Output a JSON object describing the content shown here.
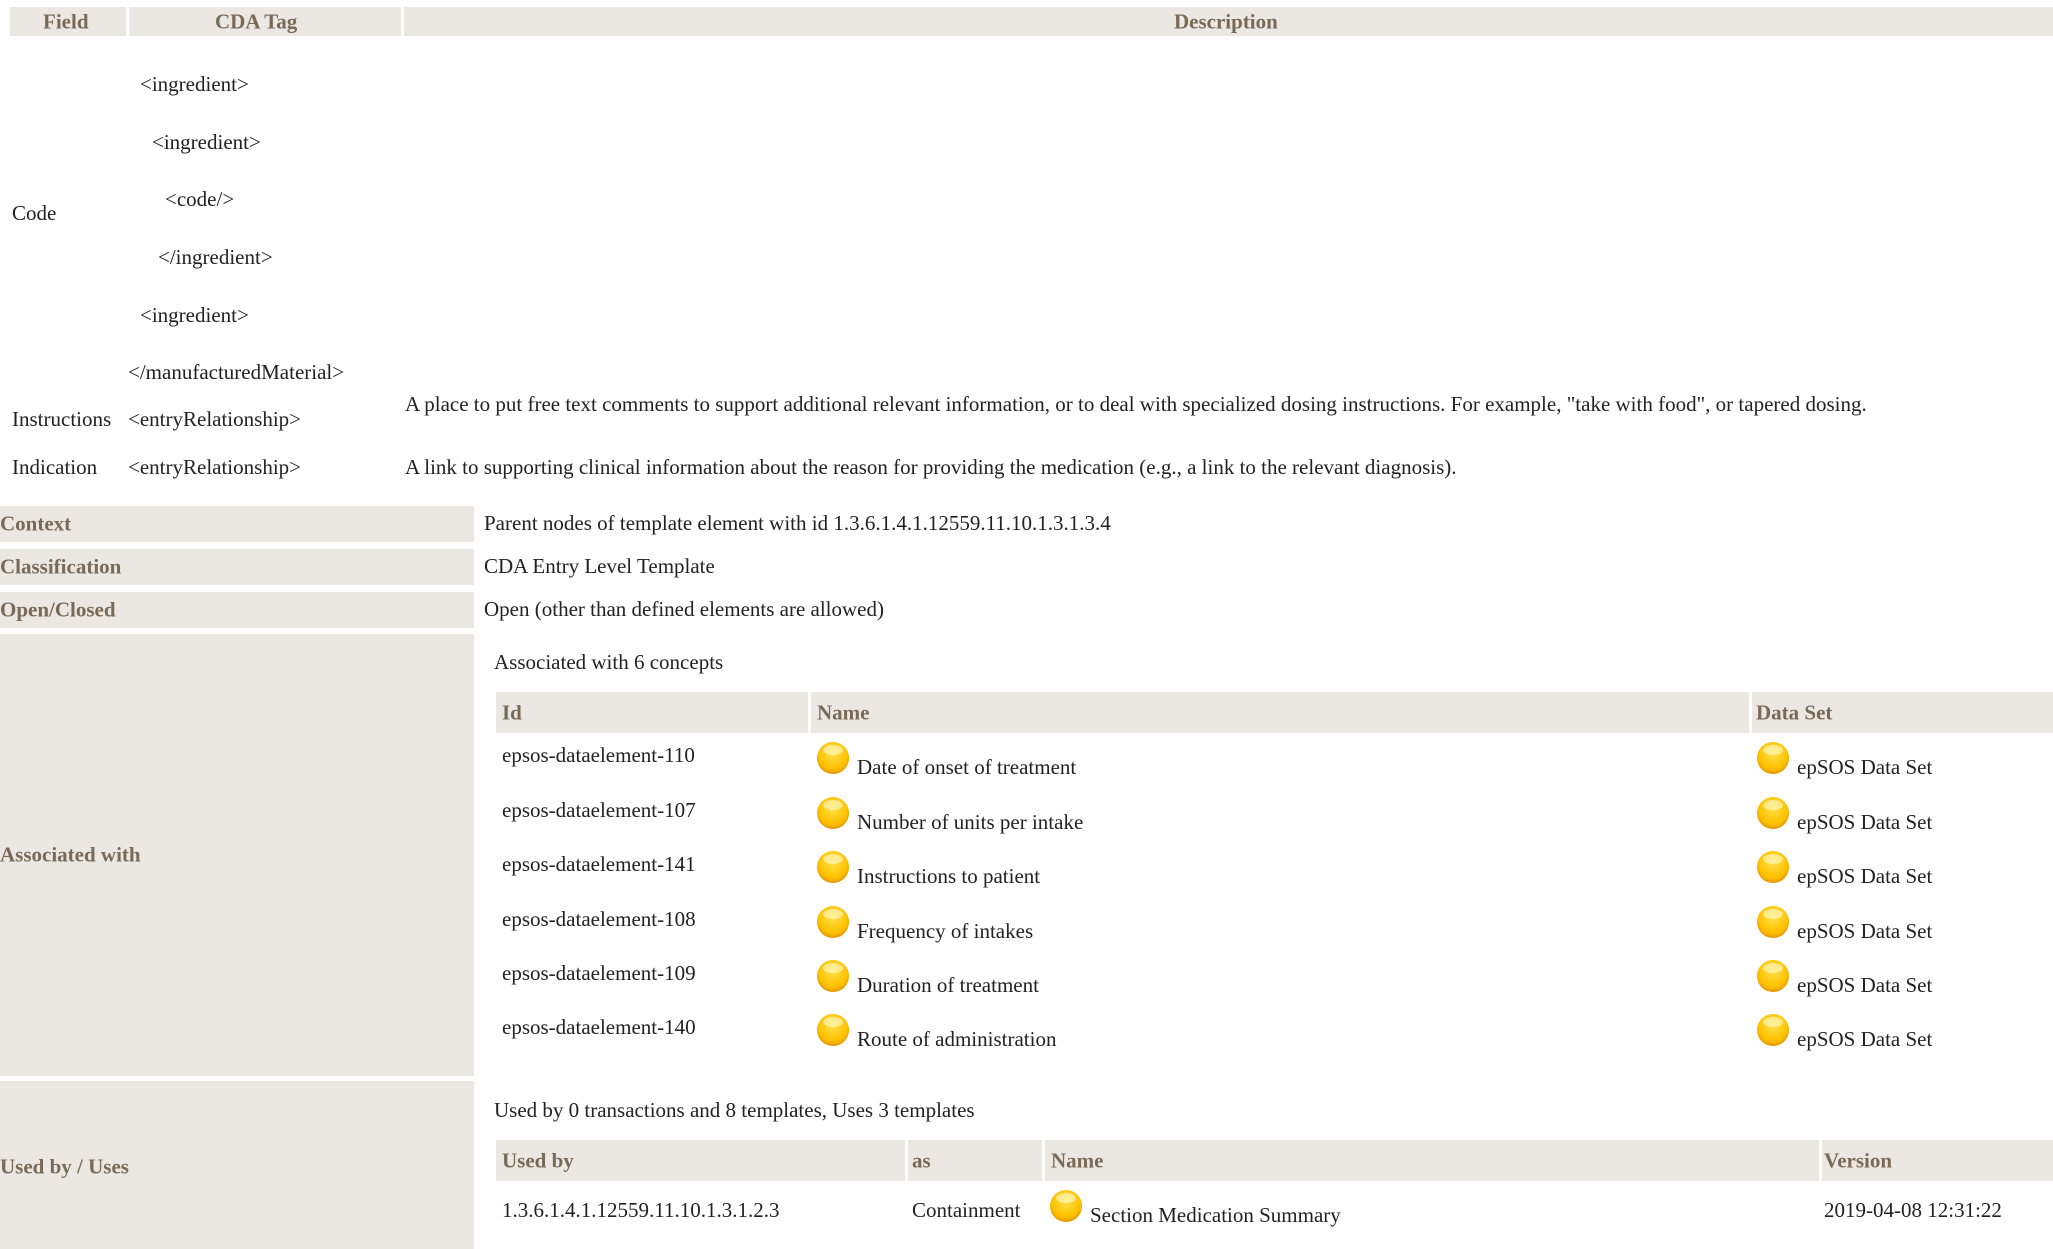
{
  "table_header": {
    "field": "Field",
    "cda_tag": "CDA Tag",
    "description": "Description"
  },
  "code_row": {
    "field": "Code",
    "tags": [
      "<ingredient>",
      "<ingredient>",
      "<code/>",
      "</ingredient>",
      "<ingredient>",
      "</manufacturedMaterial>"
    ]
  },
  "instructions_row": {
    "field": "Instructions",
    "tag": "<entryRelationship>",
    "description": "A place to put free text comments to support additional relevant information, or to deal with specialized dosing instructions. For example, \"take with food\", or tapered dosing."
  },
  "indication_row": {
    "field": "Indication",
    "tag": "<entryRelationship>",
    "description": "A link to supporting clinical information about the reason for providing the medication (e.g., a link to the relevant diagnosis)."
  },
  "meta": {
    "context_label": "Context",
    "context_value": "Parent nodes of template element with id 1.3.6.1.4.1.12559.11.10.1.3.1.3.4",
    "classification_label": "Classification",
    "classification_value": "CDA Entry Level Template",
    "openclosed_label": "Open/Closed",
    "openclosed_value": "Open (other than defined elements are allowed)"
  },
  "associated": {
    "label": "Associated with",
    "summary": "Associated with 6 concepts",
    "headers": {
      "id": "Id",
      "name": "Name",
      "dataset": "Data Set"
    },
    "rows": [
      {
        "id": "epsos-dataelement-110",
        "name": "Date of onset of treatment",
        "dataset": "epSOS Data Set",
        "icon": "yellow-status-icon"
      },
      {
        "id": "epsos-dataelement-107",
        "name": "Number of units per intake",
        "dataset": "epSOS Data Set",
        "icon": "yellow-status-icon"
      },
      {
        "id": "epsos-dataelement-141",
        "name": "Instructions to patient",
        "dataset": "epSOS Data Set",
        "icon": "yellow-status-icon"
      },
      {
        "id": "epsos-dataelement-108",
        "name": "Frequency of intakes",
        "dataset": "epSOS Data Set",
        "icon": "yellow-status-icon"
      },
      {
        "id": "epsos-dataelement-109",
        "name": "Duration of treatment",
        "dataset": "epSOS Data Set",
        "icon": "yellow-status-icon"
      },
      {
        "id": "epsos-dataelement-140",
        "name": "Route of administration",
        "dataset": "epSOS Data Set",
        "icon": "yellow-status-icon"
      }
    ]
  },
  "usedby": {
    "label": "Used by / Uses",
    "summary": "Used by 0 transactions and 8 templates, Uses 3 templates",
    "headers": {
      "used_by": "Used by",
      "as": "as",
      "name": "Name",
      "version": "Version"
    },
    "rows": [
      {
        "used_by": "1.3.6.1.4.1.12559.11.10.1.3.1.2.3",
        "as": "Containment",
        "name": "Section Medication Summary",
        "version": "2019-04-08 12:31:22",
        "icon": "yellow-status-icon"
      }
    ]
  },
  "colors": {
    "header_bg": "#ebe8e3",
    "header_text": "#7a6a55",
    "status_icon": "#ffc200"
  }
}
